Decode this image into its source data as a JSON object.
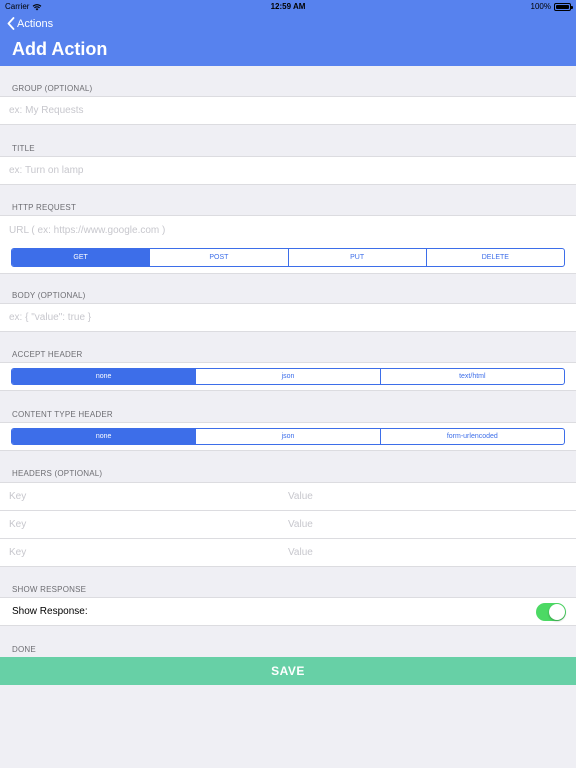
{
  "status_bar": {
    "carrier": "Carrier",
    "time": "12:59 AM",
    "battery": "100%"
  },
  "nav": {
    "back_label": "Actions",
    "title": "Add Action"
  },
  "group": {
    "header": "GROUP (OPTIONAL)",
    "placeholder": "ex: My Requests"
  },
  "title_section": {
    "header": "TITLE",
    "placeholder": "ex: Turn on lamp"
  },
  "http_request": {
    "header": "HTTP REQUEST",
    "url_placeholder": "URL ( ex: https://www.google.com )",
    "methods": [
      "GET",
      "POST",
      "PUT",
      "DELETE"
    ],
    "selected_method": "GET"
  },
  "body": {
    "header": "BODY (OPTIONAL)",
    "placeholder": "ex: { \"value\": true }"
  },
  "accept_header": {
    "header": "ACCEPT HEADER",
    "options": [
      "none",
      "json",
      "text/html"
    ],
    "selected": "none"
  },
  "content_type_header": {
    "header": "CONTENT TYPE HEADER",
    "options": [
      "none",
      "json",
      "form-urlencoded"
    ],
    "selected": "none"
  },
  "headers": {
    "header": "HEADERS (OPTIONAL)",
    "rows": [
      {
        "key_placeholder": "Key",
        "value_placeholder": "Value"
      },
      {
        "key_placeholder": "Key",
        "value_placeholder": "Value"
      },
      {
        "key_placeholder": "Key",
        "value_placeholder": "Value"
      }
    ]
  },
  "show_response": {
    "header": "SHOW RESPONSE",
    "label": "Show Response:",
    "enabled": true
  },
  "done": {
    "header": "DONE",
    "save_label": "SAVE"
  },
  "colors": {
    "nav": "#5782ee",
    "accent": "#3d6ee9",
    "toggle_on": "#4cd964",
    "save": "#67d0a6"
  }
}
